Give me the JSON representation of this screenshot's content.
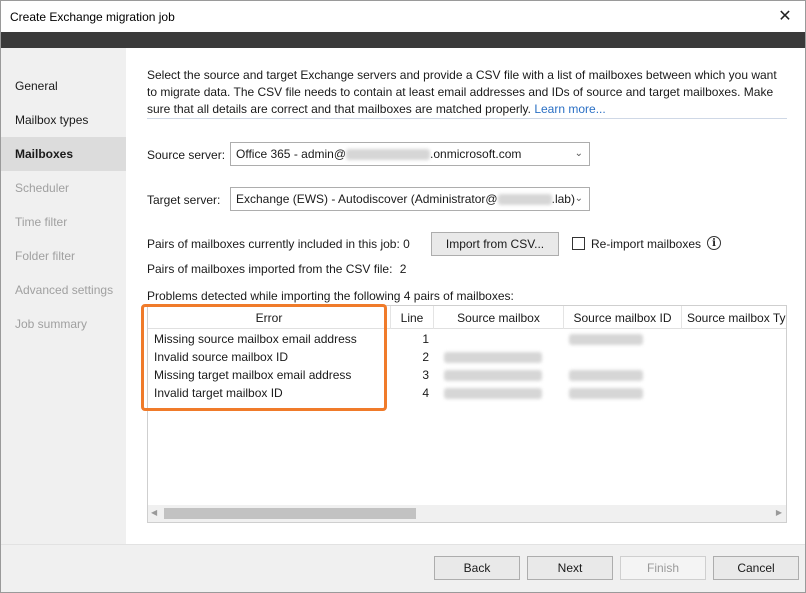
{
  "window": {
    "title": "Create Exchange migration job"
  },
  "sidebar": {
    "items": [
      {
        "label": "General",
        "state": "normal"
      },
      {
        "label": "Mailbox types",
        "state": "normal"
      },
      {
        "label": "Mailboxes",
        "state": "active"
      },
      {
        "label": "Scheduler",
        "state": "disabled"
      },
      {
        "label": "Time filter",
        "state": "disabled"
      },
      {
        "label": "Folder filter",
        "state": "disabled"
      },
      {
        "label": "Advanced settings",
        "state": "disabled"
      },
      {
        "label": "Job summary",
        "state": "disabled"
      }
    ]
  },
  "main": {
    "description": "Select the source and target Exchange servers and provide a CSV file with a list of mailboxes between which you want to migrate data. The CSV file needs to contain at least email addresses and IDs of source and target mailboxes. Make sure that all details are correct and that mailboxes are matched properly.",
    "learn_more": "Learn more...",
    "source_server_label": "Source server:",
    "source_server_prefix": "Office 365 - admin@",
    "source_server_suffix": ".onmicrosoft.com",
    "target_server_label": "Target server:",
    "target_server_prefix": "Exchange (EWS) - Autodiscover (Administrator@",
    "target_server_suffix": ".lab)",
    "pairs_included_label": "Pairs of mailboxes currently included in this job: 0",
    "import_button": "Import from CSV...",
    "reimport_label": "Re-import mailboxes",
    "pairs_imported_label": "Pairs of mailboxes imported from the CSV file:",
    "pairs_imported_value": "2",
    "problems_label": "Problems detected while importing the following 4 pairs of mailboxes:"
  },
  "grid": {
    "columns": [
      "Error",
      "Line",
      "Source mailbox",
      "Source mailbox ID",
      "Source mailbox Ty"
    ],
    "rows": [
      {
        "error": "Missing source mailbox email address",
        "line": "1"
      },
      {
        "error": "Invalid source mailbox ID",
        "line": "2"
      },
      {
        "error": "Missing target mailbox email address",
        "line": "3"
      },
      {
        "error": "Invalid target mailbox ID",
        "line": "4"
      }
    ]
  },
  "footer": {
    "back": "Back",
    "next": "Next",
    "finish": "Finish",
    "cancel": "Cancel"
  },
  "colors": {
    "highlight": "#f07b2a",
    "link": "#2a6fc4",
    "title_band": "#3a3a3a"
  }
}
